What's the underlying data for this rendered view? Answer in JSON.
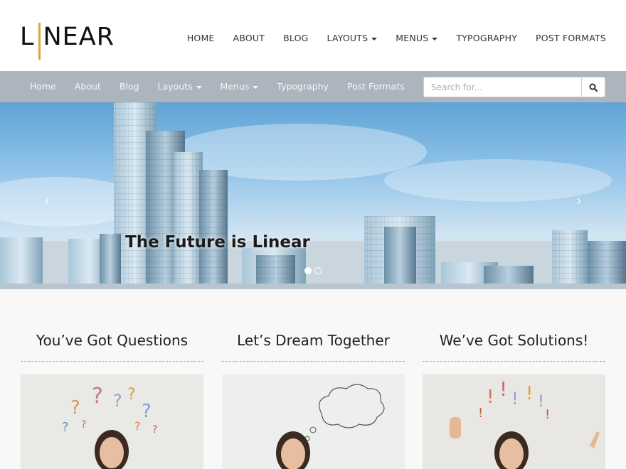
{
  "logo": {
    "text_left": "L",
    "text_right": "NEAR",
    "accent": "#d9a441"
  },
  "top_nav": {
    "items": [
      {
        "label": "HOME"
      },
      {
        "label": "ABOUT"
      },
      {
        "label": "BLOG"
      },
      {
        "label": "LAYOUTS",
        "dropdown": true
      },
      {
        "label": "MENUS",
        "dropdown": true
      },
      {
        "label": "TYPOGRAPHY"
      },
      {
        "label": "POST FORMATS"
      }
    ]
  },
  "sub_nav": {
    "items": [
      {
        "label": "Home"
      },
      {
        "label": "About"
      },
      {
        "label": "Blog"
      },
      {
        "label": "Layouts",
        "dropdown": true
      },
      {
        "label": "Menus",
        "dropdown": true
      },
      {
        "label": "Typography"
      },
      {
        "label": "Post Formats"
      }
    ],
    "background": "#acb5bd"
  },
  "search": {
    "placeholder": "Search for...",
    "button_icon": "search-icon"
  },
  "hero": {
    "caption": "The Future is Linear",
    "prev_arrow": "‹",
    "next_arrow": "›",
    "slide_count": 2,
    "active_slide": 1
  },
  "features": [
    {
      "title": "You’ve Got Questions"
    },
    {
      "title": "Let’s Dream Together"
    },
    {
      "title": "We’ve Got Solutions!"
    }
  ],
  "colors": {
    "accent": "#d9a441",
    "divider": "#d7a24a"
  }
}
